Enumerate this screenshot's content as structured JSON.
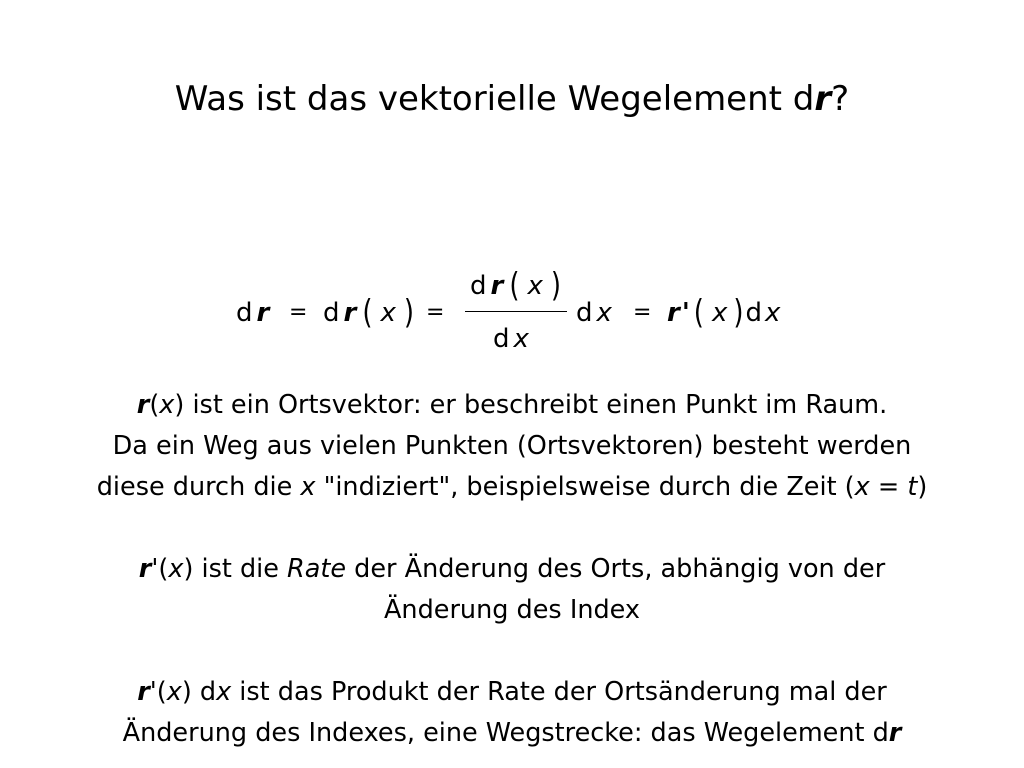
{
  "title": {
    "text_before": "Was ist das vektorielle Wegelement d",
    "r": "r",
    "text_after": "?"
  },
  "formula": {
    "d": "d",
    "r": "r",
    "x": "x",
    "equals": "=",
    "open_paren": "(",
    "close_paren": ")",
    "prime": "'"
  },
  "paragraph1": {
    "line1": {
      "r": "r",
      "open": "(",
      "x": "x",
      "rest": ") ist ein Ortsvektor: er beschreibt einen Punkt im Raum."
    },
    "line2": "Da ein Weg aus vielen Punkten (Ortsvektoren) besteht werden",
    "line3": {
      "before": "diese durch die ",
      "x": "x",
      "middle": " \"indiziert\", beispielsweise durch die Zeit (",
      "x2": "x",
      "eq": " = ",
      "t": "t",
      "end": ")"
    }
  },
  "paragraph2": {
    "line1": {
      "r": "r",
      "prime_open": "'(",
      "x": "x",
      "mid": ") ist die ",
      "rate": "Rate",
      "rest": " der Änderung des Orts, abhängig von der"
    },
    "line2": "Änderung des Index"
  },
  "paragraph3": {
    "line1": {
      "r": "r",
      "prime_open": "'(",
      "x": "x",
      "mid": ") d",
      "x2": "x",
      "rest": " ist das Produkt der Rate der Ortsänderung mal der"
    },
    "line2": {
      "text": "Änderung des Indexes, eine Wegstrecke: das Wegelement d",
      "r": "r"
    }
  }
}
